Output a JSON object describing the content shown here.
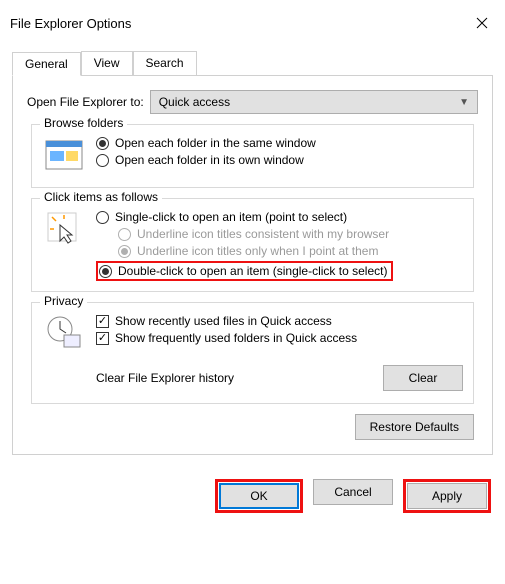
{
  "title": "File Explorer Options",
  "tabs": [
    "General",
    "View",
    "Search"
  ],
  "open_to_label": "Open File Explorer to:",
  "open_to_value": "Quick access",
  "browse": {
    "legend": "Browse folders",
    "same": "Open each folder in the same window",
    "own": "Open each folder in its own window"
  },
  "click": {
    "legend": "Click items as follows",
    "single": "Single-click to open an item (point to select)",
    "u1": "Underline icon titles consistent with my browser",
    "u2": "Underline icon titles only when I point at them",
    "double": "Double-click to open an item (single-click to select)"
  },
  "privacy": {
    "legend": "Privacy",
    "recent": "Show recently used files in Quick access",
    "freq": "Show frequently used folders in Quick access",
    "clear_label": "Clear File Explorer history",
    "clear_btn": "Clear"
  },
  "restore": "Restore Defaults",
  "ok": "OK",
  "cancel": "Cancel",
  "apply": "Apply"
}
